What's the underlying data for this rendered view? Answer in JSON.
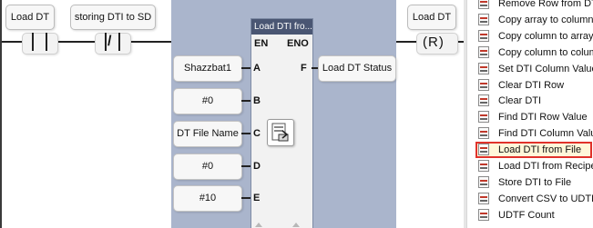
{
  "rung": {
    "contact1_tag": "Load DT",
    "contact2_tag": "storing DTI to SD",
    "coil_tag": "Load DT",
    "coil_symbol": "(R)",
    "contact2_symbol": "/"
  },
  "function_block": {
    "title": "Load DTI fro...",
    "en_label": "EN",
    "eno_label": "ENO",
    "inputs": [
      {
        "pin": "A",
        "value": "Shazzbat1"
      },
      {
        "pin": "B",
        "value": "#0"
      },
      {
        "pin": "C",
        "value": "DT File Name"
      },
      {
        "pin": "D",
        "value": "#0"
      },
      {
        "pin": "E",
        "value": "#10"
      }
    ],
    "output": {
      "pin": "F",
      "value": "Load DT Status"
    },
    "icon": "load-file-icon"
  },
  "toolbox": {
    "items": [
      {
        "label": "Remove Row from DTI",
        "icon": "remove-row-icon"
      },
      {
        "label": "Copy array to column",
        "icon": "copy-array-icon"
      },
      {
        "label": "Copy column to array",
        "icon": "copy-column-array-icon"
      },
      {
        "label": "Copy column to column",
        "icon": "copy-column-column-icon"
      },
      {
        "label": "Set DTI Column Value",
        "icon": "set-column-icon"
      },
      {
        "label": "Clear DTI Row",
        "icon": "clear-row-icon"
      },
      {
        "label": "Clear DTI",
        "icon": "clear-dti-icon"
      },
      {
        "label": "Find DTI Row Value",
        "icon": "find-row-icon"
      },
      {
        "label": "Find DTI Column Value",
        "icon": "find-column-icon"
      },
      {
        "label": "Load DTI from File",
        "icon": "load-file-icon",
        "selected": true
      },
      {
        "label": "Load DTI from Recipe",
        "icon": "load-recipe-icon"
      },
      {
        "label": "Store DTI to File",
        "icon": "store-file-icon"
      },
      {
        "label": "Convert CSV to UDTF",
        "icon": "convert-csv-icon"
      },
      {
        "label": "UDTF Count",
        "icon": "udtf-count-icon"
      }
    ]
  },
  "colors": {
    "fb_area": "#aab5cc",
    "fb_title": "#4a5673",
    "selection_border": "#e0322b"
  }
}
